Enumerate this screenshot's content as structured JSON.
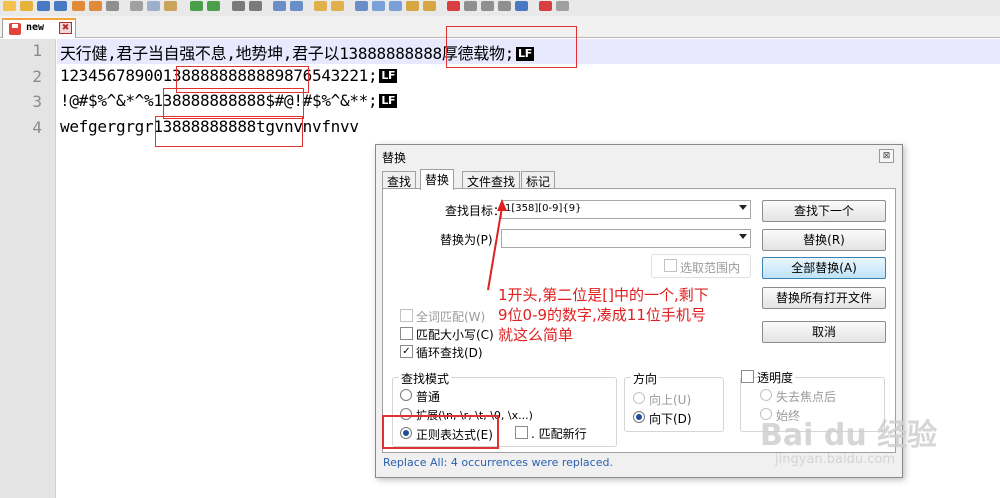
{
  "tab": {
    "label": "new",
    "close_label": "✖"
  },
  "editor": {
    "lines": [
      {
        "num": "1",
        "text": "天行健,君子当自强不息,地势坤,君子以13888888888厚德载物;",
        "lf": "LF"
      },
      {
        "num": "2",
        "text": "123456789001388888888889876543221;",
        "lf": "LF"
      },
      {
        "num": "3",
        "text": "!@#$%^&*^%138888888888$#@!#$%^&**;",
        "lf": "LF"
      },
      {
        "num": "4",
        "text": "wefgergrgr13888888888tgvnvnvfnvv",
        "lf": ""
      }
    ]
  },
  "dialog": {
    "title": "替换",
    "close": "⊠",
    "tabs": [
      "查找",
      "替换",
      "文件查找",
      "标记"
    ],
    "find_label": "查找目标：",
    "find_value": "1[358][0-9]{9}",
    "replace_label": "替换为(P)",
    "replace_value": "",
    "in_selection": "选取范围内",
    "buttons": {
      "find_next": "查找下一个",
      "replace": "替换(R)",
      "replace_all": "全部替换(A)",
      "replace_all_open": "替换所有打开文件",
      "cancel": "取消"
    },
    "options": {
      "whole_word": "全词匹配(W)",
      "match_case": "匹配大小写(C)",
      "wrap": "循环查找(D)"
    },
    "search_mode": {
      "title": "查找模式",
      "normal": "普通",
      "extended": "扩展(\\n, \\r, \\t, \\0, \\x...)",
      "regex": "正则表达式(E)",
      "dot_newline": ". 匹配新行"
    },
    "direction": {
      "title": "方向",
      "up": "向上(U)",
      "down": "向下(D)"
    },
    "transparency": {
      "title": "透明度",
      "on_lose_focus": "失去焦点后",
      "always": "始终"
    },
    "status": "Replace All: 4 occurrences were replaced."
  },
  "annotation": {
    "lines": [
      "1开头,第二位是[]中的一个,剩下",
      "9位0-9的数字,凑成11位手机号",
      "就这么简单"
    ]
  },
  "watermark": {
    "main": "Bai du 经验",
    "sub": "jingyan.baidu.com"
  },
  "colors": {
    "annotation_red": "#e02020",
    "status_blue": "#2a5fb0",
    "tab_accent": "#f7a33b"
  }
}
